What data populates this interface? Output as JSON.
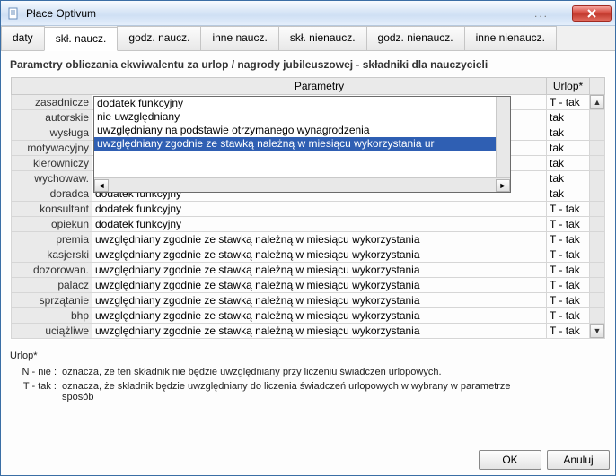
{
  "window": {
    "title": "Płace Optivum",
    "ellipsis": "...",
    "close_aria": "Close"
  },
  "tabs": [
    {
      "id": "daty",
      "label": "daty"
    },
    {
      "id": "skl-naucz",
      "label": "skł. naucz."
    },
    {
      "id": "godz-naucz",
      "label": "godz. naucz."
    },
    {
      "id": "inne-naucz",
      "label": "inne naucz."
    },
    {
      "id": "skl-nienaucz",
      "label": "skł. nienaucz."
    },
    {
      "id": "godz-nienaucz",
      "label": "godz. nienaucz."
    },
    {
      "id": "inne-nienaucz",
      "label": "inne nienaucz."
    }
  ],
  "active_tab": "skl-naucz",
  "heading": "Parametry obliczania ekwiwalentu za urlop / nagrody jubileuszowej - składniki dla nauczycieli",
  "columns": {
    "label_header": "",
    "param": "Parametry",
    "urlop": "Urlop*"
  },
  "rows": [
    {
      "label": "zasadnicze",
      "param": "uwzględniany zgodnie ze stawką należną w miesiącu wykorzystania",
      "urlop": "T - tak"
    },
    {
      "label": "autorskie",
      "param": "dodatek funkcyjny",
      "urlop": "tak"
    },
    {
      "label": "wysługa",
      "param": "nie uwzględniany",
      "urlop": "tak"
    },
    {
      "label": "motywacyjny",
      "param": "uwzględniany na podstawie otrzymanego wynagrodzenia",
      "urlop": "tak"
    },
    {
      "label": "kierowniczy",
      "param": "uwzględniany zgodnie ze stawką należną w miesiącu wykorzystania ur",
      "urlop": "tak"
    },
    {
      "label": "wychowaw.",
      "param": "",
      "urlop": "tak"
    },
    {
      "label": "doradca",
      "param": "dodatek funkcyjny",
      "urlop": "tak"
    },
    {
      "label": "konsultant",
      "param": "dodatek funkcyjny",
      "urlop": "T - tak"
    },
    {
      "label": "opiekun",
      "param": "dodatek funkcyjny",
      "urlop": "T - tak"
    },
    {
      "label": "premia",
      "param": "uwzględniany zgodnie ze stawką należną w miesiącu wykorzystania",
      "urlop": "T - tak"
    },
    {
      "label": "kasjerski",
      "param": "uwzględniany zgodnie ze stawką należną w miesiącu wykorzystania",
      "urlop": "T - tak"
    },
    {
      "label": "dozorowan.",
      "param": "uwzględniany zgodnie ze stawką należną w miesiącu wykorzystania",
      "urlop": "T - tak"
    },
    {
      "label": "palacz",
      "param": "uwzględniany zgodnie ze stawką należną w miesiącu wykorzystania",
      "urlop": "T - tak"
    },
    {
      "label": "sprzątanie",
      "param": "uwzględniany zgodnie ze stawką należną w miesiącu wykorzystania",
      "urlop": "T - tak"
    },
    {
      "label": "bhp",
      "param": "uwzględniany zgodnie ze stawką należną w miesiącu wykorzystania",
      "urlop": "T - tak"
    },
    {
      "label": "uciążliwe",
      "param": "uwzględniany zgodnie ze stawką należną w miesiącu wykorzystania",
      "urlop": "T - tak"
    }
  ],
  "dropdown": {
    "options": [
      "dodatek funkcyjny",
      "nie uwzględniany",
      "uwzględniany na podstawie otrzymanego wynagrodzenia",
      "uwzględniany zgodnie ze stawką należną w miesiącu wykorzystania ur"
    ],
    "selected_index": 3
  },
  "legend": {
    "title": "Urlop*",
    "rows": [
      {
        "key": "N - nie :",
        "val": "oznacza, że ten składnik nie będzie uwzględniany przy liczeniu świadczeń urlopowych."
      },
      {
        "key": "T - tak :",
        "val": "oznacza, że składnik będzie uwzględniany do liczenia świadczeń urlopowych w wybrany w parametrze sposób"
      }
    ]
  },
  "buttons": {
    "ok": "OK",
    "cancel": "Anuluj"
  }
}
